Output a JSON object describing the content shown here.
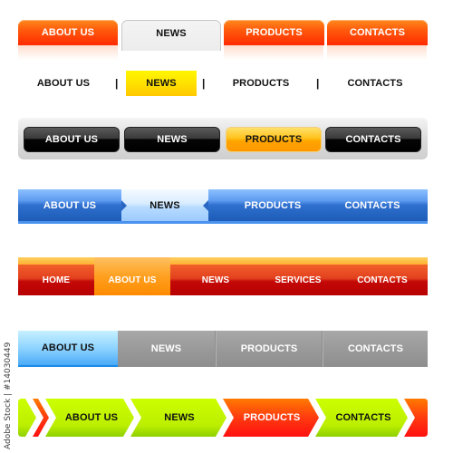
{
  "bars": {
    "tabs_orange": {
      "items": [
        {
          "label": "ABOUT US",
          "active": false
        },
        {
          "label": "NEWS",
          "active": true
        },
        {
          "label": "PRODUCTS",
          "active": false
        },
        {
          "label": "CONTACTS",
          "active": false
        }
      ],
      "colors": {
        "tab": "#ff4a0a",
        "active": "#efefef"
      }
    },
    "text_separated": {
      "items": [
        {
          "label": "ABOUT US",
          "active": false
        },
        {
          "label": "NEWS",
          "active": true
        },
        {
          "label": "PRODUCTS",
          "active": false
        },
        {
          "label": "CONTACTS",
          "active": false
        }
      ],
      "separator": "|",
      "colors": {
        "active": "#ffd800"
      }
    },
    "glossy_black": {
      "items": [
        {
          "label": "ABOUT US",
          "active": false
        },
        {
          "label": "NEWS",
          "active": false
        },
        {
          "label": "PRODUCTS",
          "active": true
        },
        {
          "label": "CONTACTS",
          "active": false
        }
      ],
      "colors": {
        "button": "#000000",
        "active": "#ffb000",
        "background": "#dcdcdc"
      }
    },
    "blue_bar": {
      "items": [
        {
          "label": "ABOUT US",
          "active": false
        },
        {
          "label": "NEWS",
          "active": true
        },
        {
          "label": "PRODUCTS",
          "active": false
        },
        {
          "label": "CONTACTS",
          "active": false
        }
      ],
      "colors": {
        "bar": "#2f6fce",
        "active": "#c8e4ff"
      }
    },
    "red_bar": {
      "items": [
        {
          "label": "HOME",
          "active": false
        },
        {
          "label": "ABOUT US",
          "active": true
        },
        {
          "label": "NEWS",
          "active": false
        },
        {
          "label": "SERVICES",
          "active": false
        },
        {
          "label": "CONTACTS",
          "active": false
        }
      ],
      "colors": {
        "bar": "#c40808",
        "active": "#ffa020",
        "strip": "#ffc040"
      }
    },
    "grey_bar": {
      "items": [
        {
          "label": "ABOUT US",
          "active": true
        },
        {
          "label": "NEWS",
          "active": false
        },
        {
          "label": "PRODUCTS",
          "active": false
        },
        {
          "label": "CONTACTS",
          "active": false
        }
      ],
      "colors": {
        "bar": "#9a9a9a",
        "active": "#8fd4ff"
      }
    },
    "chevron_bar": {
      "items": [
        {
          "label": "ABOUT US",
          "style": "green"
        },
        {
          "label": "NEWS",
          "style": "green"
        },
        {
          "label": "PRODUCTS",
          "style": "red"
        },
        {
          "label": "CONTACTS",
          "style": "green"
        }
      ],
      "colors": {
        "green": "#c4f000",
        "red": "#ff2a10"
      }
    }
  },
  "credit": "Adobe Stock | #14030449"
}
